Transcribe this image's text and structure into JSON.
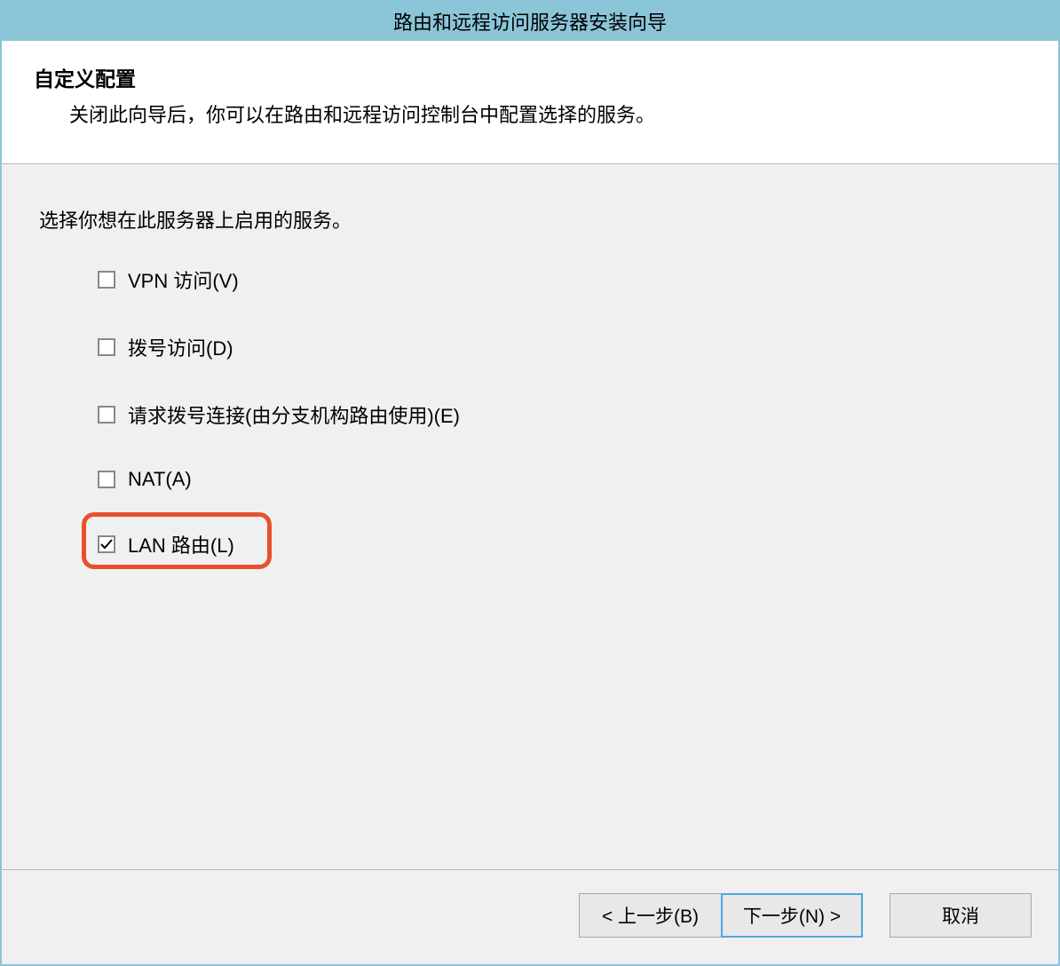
{
  "window": {
    "title": "路由和远程访问服务器安装向导"
  },
  "header": {
    "title": "自定义配置",
    "subtitle": "关闭此向导后，你可以在路由和远程访问控制台中配置选择的服务。"
  },
  "body": {
    "instruction": "选择你想在此服务器上启用的服务。",
    "options": [
      {
        "label": "VPN 访问(V)",
        "checked": false,
        "highlighted": false
      },
      {
        "label": "拨号访问(D)",
        "checked": false,
        "highlighted": false
      },
      {
        "label": "请求拨号连接(由分支机构路由使用)(E)",
        "checked": false,
        "highlighted": false
      },
      {
        "label": "NAT(A)",
        "checked": false,
        "highlighted": false
      },
      {
        "label": "LAN 路由(L)",
        "checked": true,
        "highlighted": true
      }
    ]
  },
  "footer": {
    "back_label": "< 上一步(B)",
    "next_label": "下一步(N) >",
    "cancel_label": "取消"
  }
}
